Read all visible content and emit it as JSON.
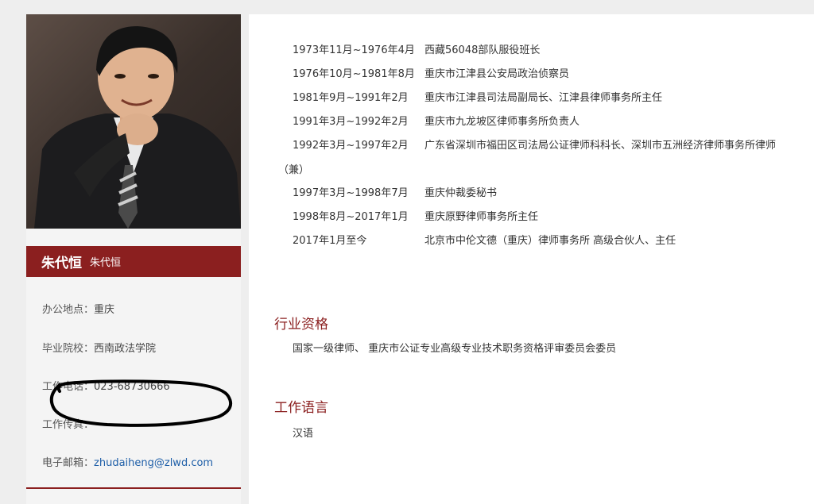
{
  "profile": {
    "name": "朱代恒",
    "name_alt": "朱代恒",
    "office_label": "办公地点：",
    "office_value": "重庆",
    "school_label": "毕业院校：",
    "school_value": "西南政法学院",
    "phone_label": "工作电话：",
    "phone_value": "023-68730666",
    "fax_label": "工作传真：",
    "fax_value": "",
    "email_label": "电子邮箱：",
    "email_value": "zhudaiheng@zlwd.com"
  },
  "resume": [
    {
      "date": "1973年11月~1976年4月",
      "desc": "西藏56048部队服役班长"
    },
    {
      "date": "1976年10月~1981年8月",
      "desc": "重庆市江津县公安局政治侦察员"
    },
    {
      "date": "1981年9月~1991年2月",
      "desc": "重庆市江津县司法局副局长、江津县律师事务所主任"
    },
    {
      "date": "1991年3月~1992年2月",
      "desc": "重庆市九龙坡区律师事务所负责人"
    },
    {
      "date": "1992年3月~1997年2月",
      "desc": "广东省深圳市福田区司法局公证律师科科长、深圳市五洲经济律师事务所律师"
    },
    {
      "date": "1997年3月~1998年7月",
      "desc": "重庆仲裁委秘书"
    },
    {
      "date": "1998年8月~2017年1月",
      "desc": "重庆原野律师事务所主任"
    },
    {
      "date": "2017年1月至今",
      "desc": "北京市中伦文德（重庆）律师事务所 高级合伙人、主任"
    }
  ],
  "resume_wrap": "（兼）",
  "qualification": {
    "heading": "行业资格",
    "text": "国家一级律师、 重庆市公证专业高级专业技术职务资格评审委员会委员"
  },
  "language": {
    "heading": "工作语言",
    "text": "汉语"
  },
  "colors": {
    "accent": "#8b1f1f",
    "link": "#1f5fa8"
  }
}
